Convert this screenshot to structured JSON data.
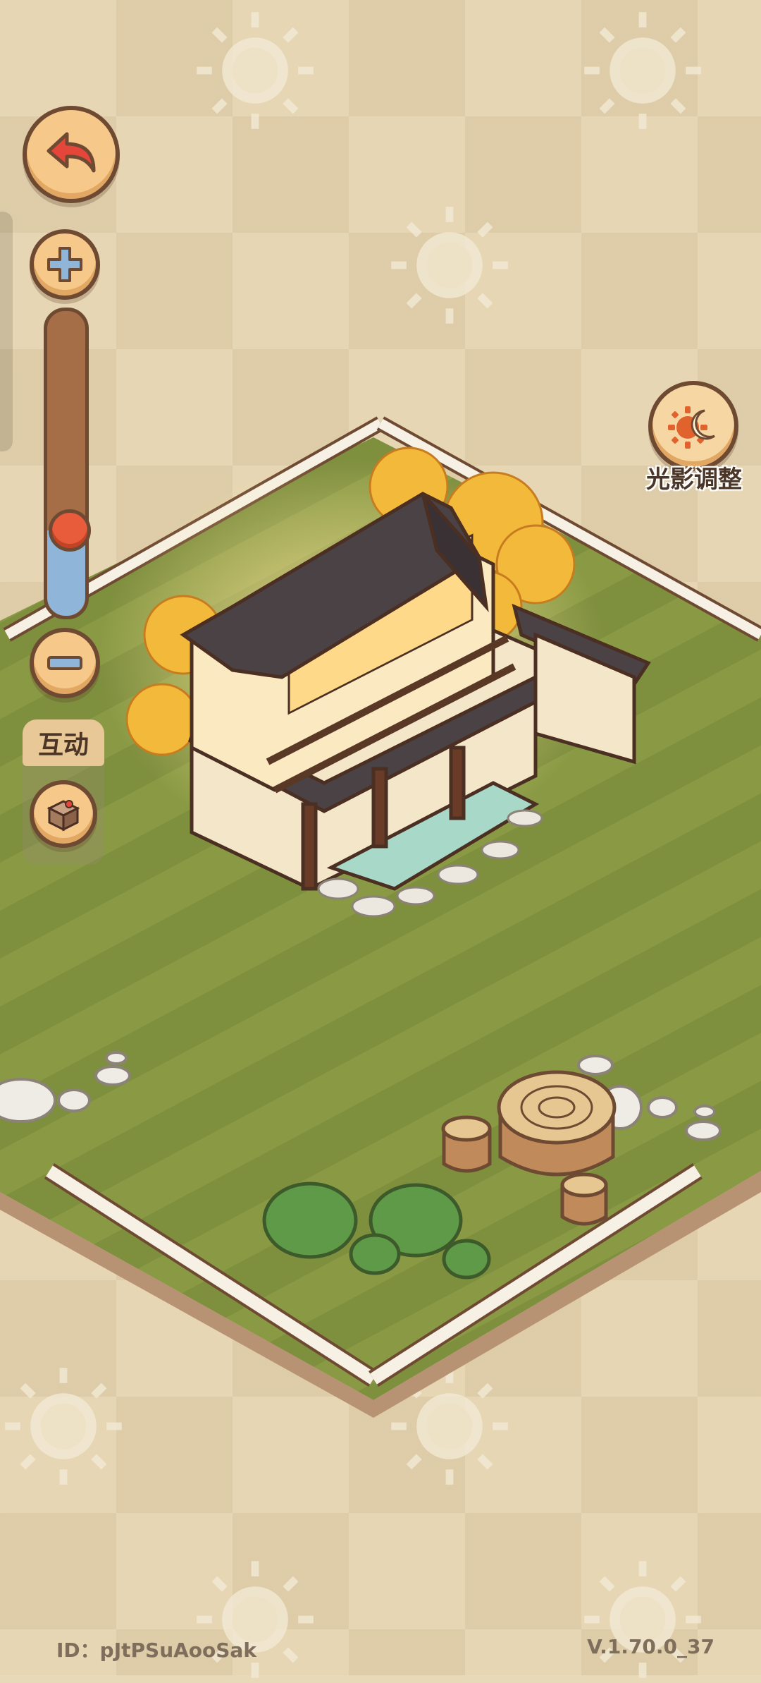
{
  "player_id": "ID：pJtPSuAooSak",
  "version": "V.1.70.0_37",
  "buttons": {
    "interact_label": "互动",
    "light_adjust_label": "光影调整"
  },
  "zoom": {
    "level": 0.28
  },
  "icons": {
    "back": "back-arrow-icon",
    "zoom_in": "plus-icon",
    "zoom_out": "minus-icon",
    "interact": "box-icon",
    "light": "sun-moon-icon"
  }
}
